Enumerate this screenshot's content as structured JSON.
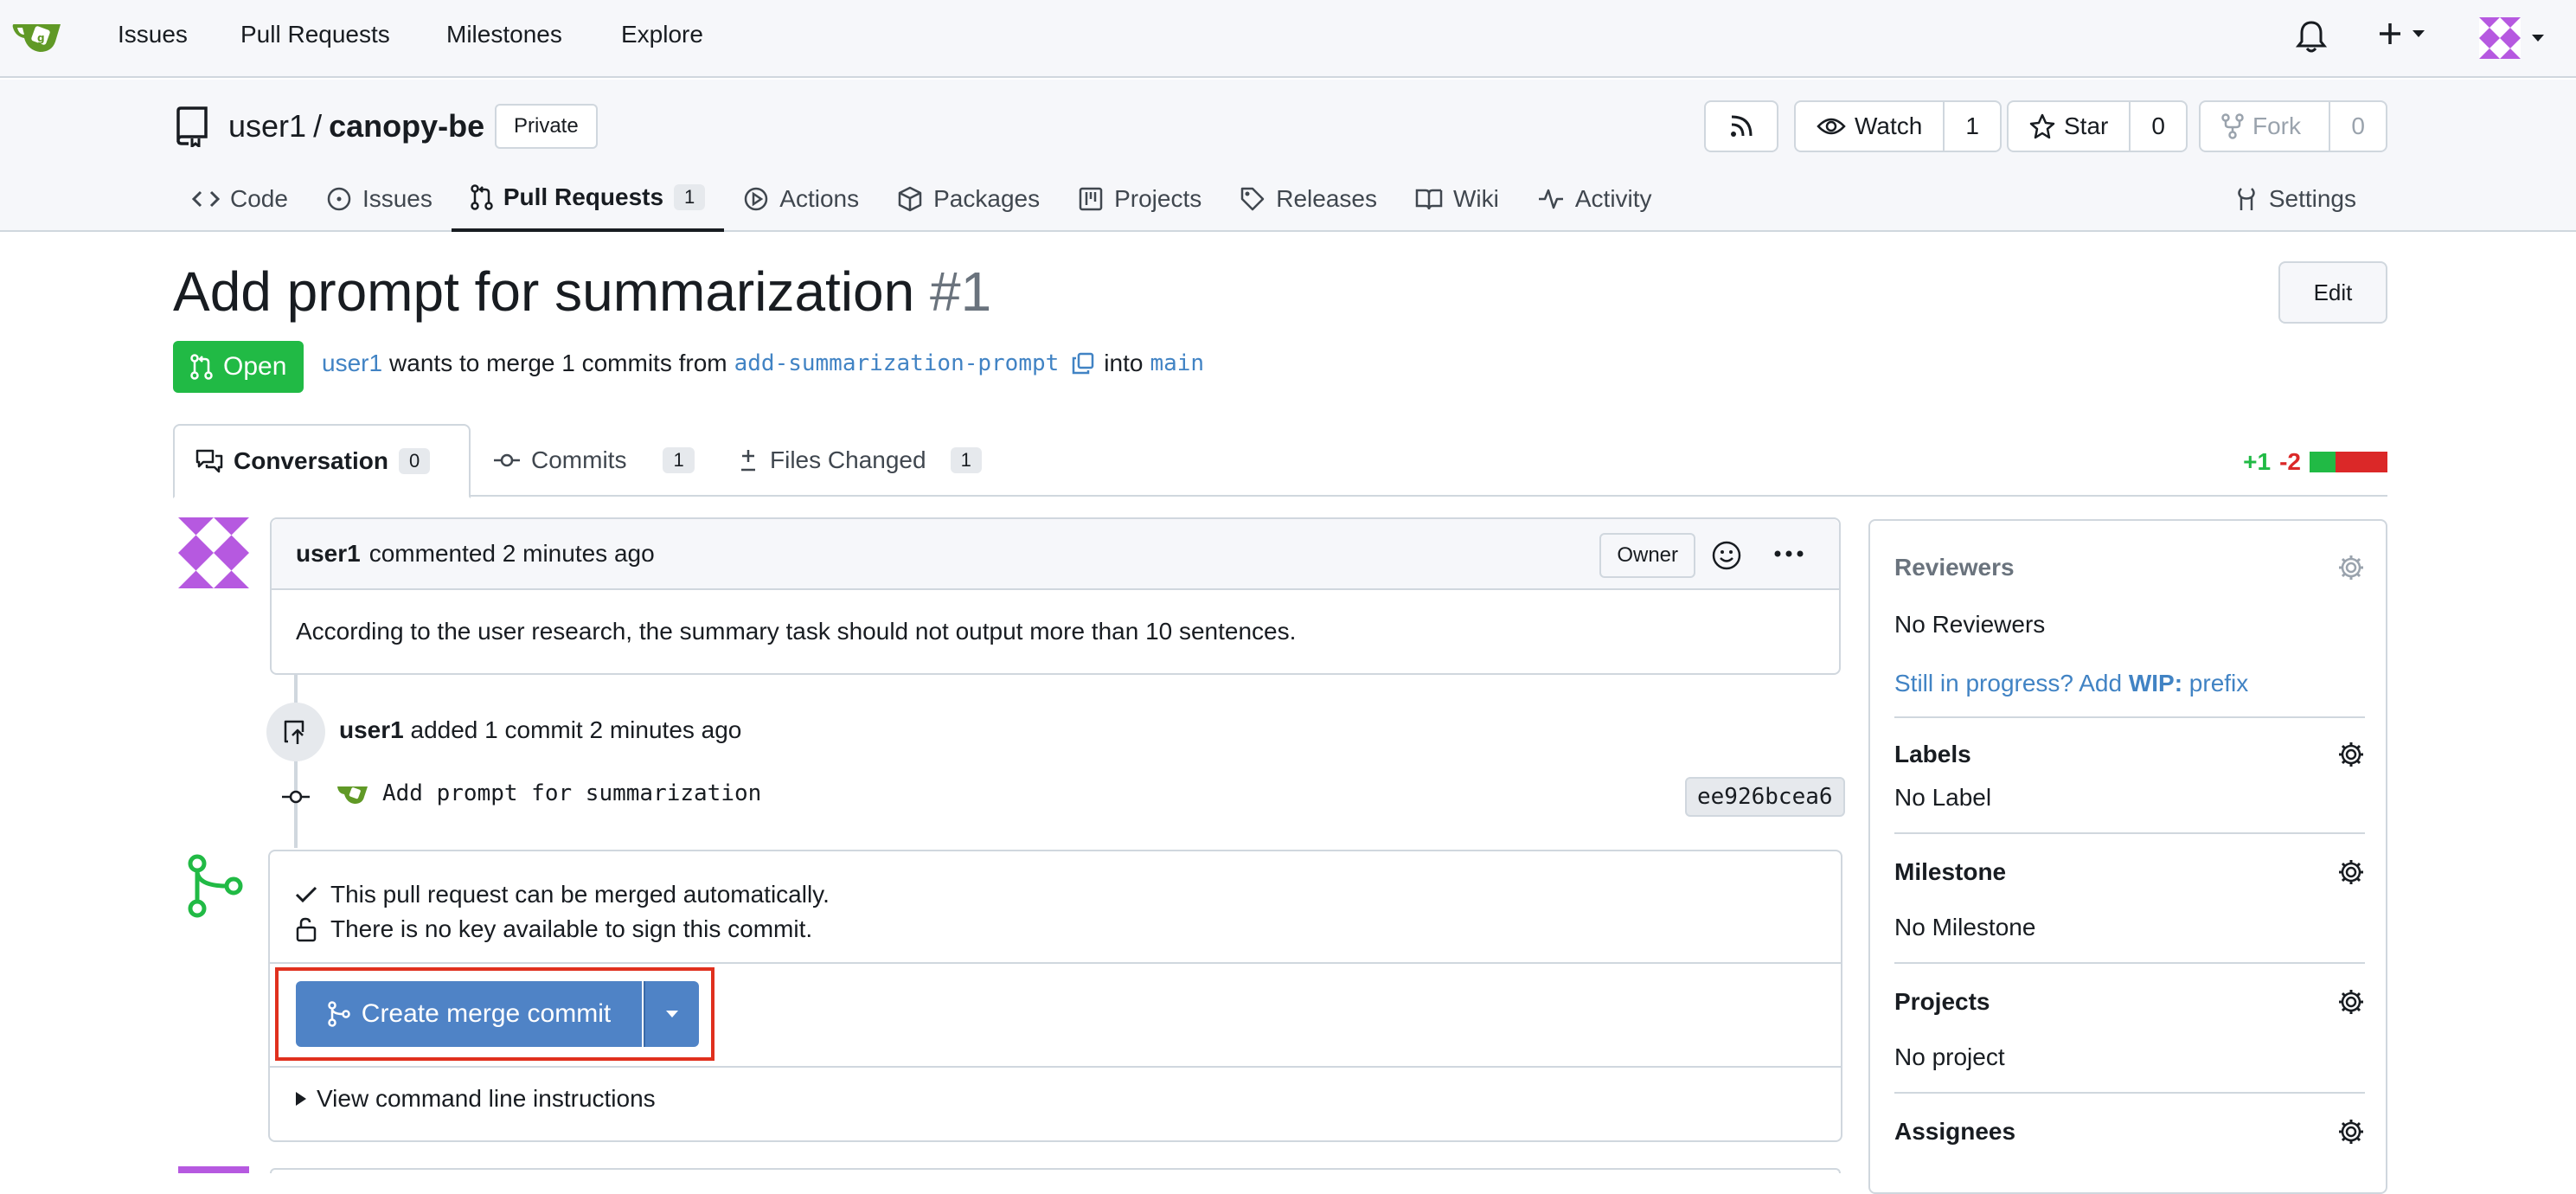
{
  "topnav": {
    "items": [
      "Issues",
      "Pull Requests",
      "Milestones",
      "Explore"
    ]
  },
  "repo": {
    "owner": "user1",
    "separator": "/",
    "name": "canopy-be",
    "visibility": "Private",
    "watch_label": "Watch",
    "watch_count": "1",
    "star_label": "Star",
    "star_count": "0",
    "fork_label": "Fork",
    "fork_count": "0"
  },
  "repo_tabs": {
    "code": "Code",
    "issues": "Issues",
    "pulls": "Pull Requests",
    "pulls_count": "1",
    "actions": "Actions",
    "packages": "Packages",
    "projects": "Projects",
    "releases": "Releases",
    "wiki": "Wiki",
    "activity": "Activity",
    "settings": "Settings"
  },
  "pr": {
    "title": "Add prompt for summarization",
    "number": "#1",
    "edit_label": "Edit",
    "state": "Open",
    "author": "user1",
    "merge_text": "wants to merge 1 commits from",
    "head_branch": "add-summarization-prompt",
    "into_text": "into",
    "base_branch": "main"
  },
  "pr_tabs": {
    "conversation": "Conversation",
    "conversation_count": "0",
    "commits": "Commits",
    "commits_count": "1",
    "files": "Files Changed",
    "files_count": "1",
    "additions": "+1",
    "deletions": "-2"
  },
  "comment": {
    "author": "user1",
    "meta": "commented 2 minutes ago",
    "role": "Owner",
    "body": "According to the user research, the summary task should not output more than 10 sentences."
  },
  "commit_event": {
    "author": "user1",
    "meta": "added 1 commit 2 minutes ago",
    "message": "Add prompt for summarization",
    "sha": "ee926bcea6"
  },
  "merge": {
    "status_ok": "This pull request can be merged automatically.",
    "status_key": "There is no key available to sign this commit.",
    "button_label": "Create merge commit",
    "cli_label": "View command line instructions"
  },
  "sidebar": {
    "reviewers_title": "Reviewers",
    "reviewers_value": "No Reviewers",
    "wip_prefix_text": "Still in progress? Add ",
    "wip_bold": "WIP:",
    "wip_suffix": " prefix",
    "labels_title": "Labels",
    "labels_value": "No Label",
    "milestone_title": "Milestone",
    "milestone_value": "No Milestone",
    "projects_title": "Projects",
    "projects_value": "No project",
    "assignees_title": "Assignees"
  },
  "colors": {
    "accent": "#4183c4",
    "open_green": "#21ba45",
    "merge_button": "#4f83c6",
    "highlight_red": "#e0301e"
  }
}
